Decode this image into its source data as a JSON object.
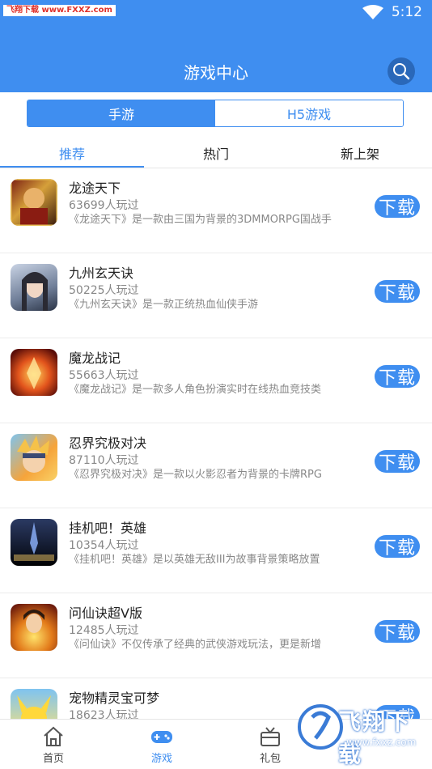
{
  "status": {
    "time": "5:12",
    "watermark": "飞翔下载 www.FXXZ.com"
  },
  "header": {
    "title": "游戏中心"
  },
  "segments": [
    "手游",
    "H5游戏"
  ],
  "tabs": [
    "推荐",
    "热门",
    "新上架"
  ],
  "games": [
    {
      "name": "龙途天下",
      "plays": "63699人玩过",
      "desc": "《龙途天下》是一款由三国为背景的3DMMORPG国战手",
      "button": "下载"
    },
    {
      "name": "九州玄天诀",
      "plays": "50225人玩过",
      "desc": "《九州玄天诀》是一款正统热血仙侠手游",
      "button": "下载"
    },
    {
      "name": "魔龙战记",
      "plays": "55663人玩过",
      "desc": "《魔龙战记》是一款多人角色扮演实时在线热血竞技类",
      "button": "下载"
    },
    {
      "name": "忍界究极对决",
      "plays": "87110人玩过",
      "desc": "《忍界究极对决》是一款以火影忍者为背景的卡牌RPG",
      "button": "下载"
    },
    {
      "name": "挂机吧！英雄",
      "plays": "10354人玩过",
      "desc": "《挂机吧！英雄》是以英雄无敌III为故事背景策略放置",
      "button": "下载"
    },
    {
      "name": "问仙诀超V版",
      "plays": "12485人玩过",
      "desc": "《问仙诀》不仅传承了经典的武侠游戏玩法，更是新增",
      "button": "下载"
    },
    {
      "name": "宠物精灵宝可梦",
      "plays": "18623人玩过",
      "desc": "",
      "button": "下载"
    }
  ],
  "nav": [
    "首页",
    "游戏",
    "礼包"
  ],
  "watermark_bottom": {
    "title": "飞翔下载",
    "url": "www.fxxz.com"
  },
  "colors": {
    "accent": "#3f8ef0",
    "header_dark": "#2a68b9"
  }
}
